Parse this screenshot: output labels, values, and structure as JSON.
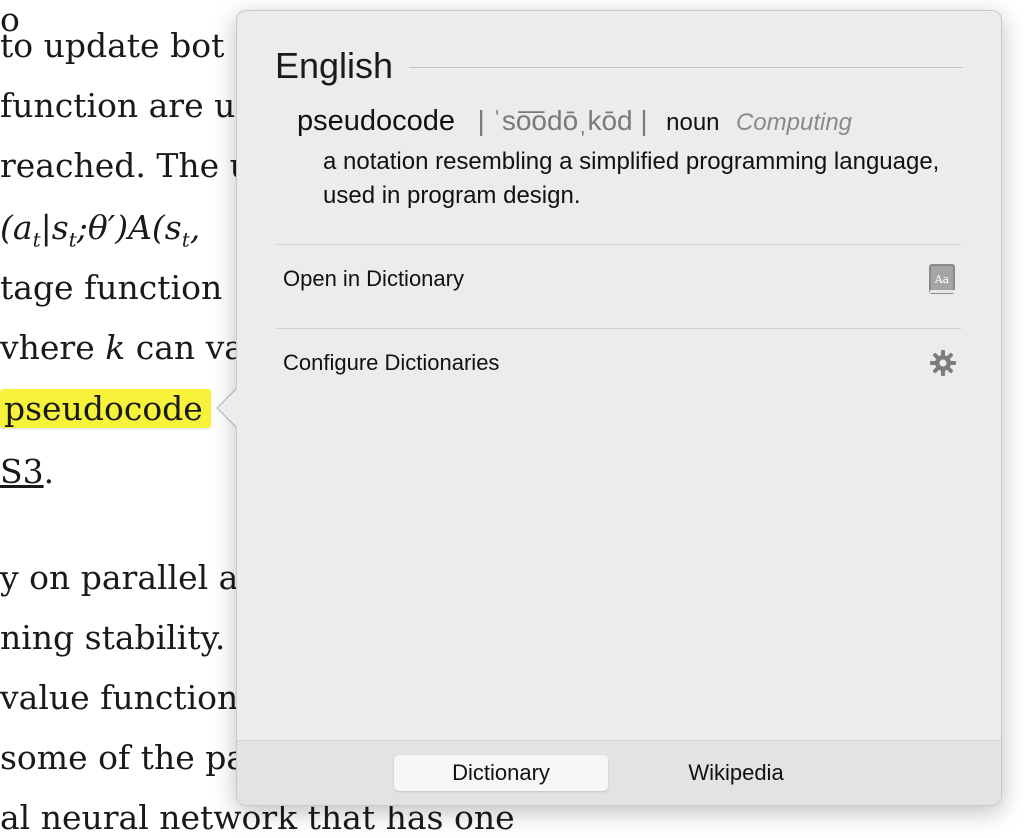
{
  "document": {
    "lines": [
      "to update bot",
      "function are u",
      "reached. The u",
      "tage function",
      "vhere k can va",
      "pseudocode",
      "S3.",
      "y on parallel ac",
      "ning stability.",
      "value function",
      "some of the pa",
      "al neural network that has one"
    ],
    "math_line": "(a_t|s_t;θ′)A(s_t,"
  },
  "popover": {
    "section_title": "English",
    "headword": "pseudocode",
    "pronunciation": "| ˈso͞odōˌkōd |",
    "part_of_speech": "noun",
    "domain": "Computing",
    "definition": "a notation resembling a simplified programming language, used in program design.",
    "actions": [
      {
        "label": "Open in Dictionary",
        "icon": "dictionary-app-icon"
      },
      {
        "label": "Configure Dictionaries",
        "icon": "gear-icon"
      }
    ],
    "tabs": [
      {
        "label": "Dictionary",
        "active": true
      },
      {
        "label": "Wikipedia",
        "active": false
      }
    ]
  },
  "colors": {
    "highlight": "#f7f23a",
    "popover_bg": "#ececec"
  }
}
